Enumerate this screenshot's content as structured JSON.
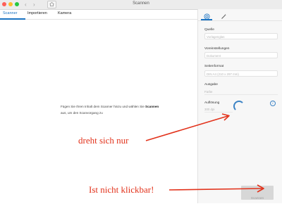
{
  "window": {
    "title": "Scannen",
    "back_glyph": "‹",
    "forward_glyph": "›"
  },
  "tabs": [
    {
      "label": "Scanner",
      "active": true
    },
    {
      "label": "Importieren",
      "active": false
    },
    {
      "label": "Kamera",
      "active": false
    }
  ],
  "main": {
    "instruction_part1": "Fügen Sie Ihren Inhalt dem Scanner hinzu und wählen Sie ",
    "instruction_bold": "Scannen",
    "instruction_part2": " aus, um den Scanvorgang zu"
  },
  "sidebar": {
    "icons": [
      "scanner-settings-icon",
      "magic-wand-icon"
    ],
    "fields": [
      {
        "label": "Quelle",
        "value": "Vorlagenglas"
      },
      {
        "label": "Voreinstellungen",
        "value": "Dokument"
      },
      {
        "label": "Seitenformat",
        "value": "DIN A4 (210 x 297 mm)"
      },
      {
        "label": "Ausgabe",
        "value": "Farbe"
      },
      {
        "label": "Auflösung",
        "value": "300 dpi"
      }
    ],
    "info_glyph": "i",
    "scan_button_label": "Scannen"
  },
  "annotations": {
    "spinning_note": "dreht sich nur",
    "not_clickable_note": "Ist nicht klickbar!"
  },
  "colors": {
    "accent": "#1a73c2",
    "annotation": "#e2321b",
    "disabled_button": "#d7d7d7"
  }
}
